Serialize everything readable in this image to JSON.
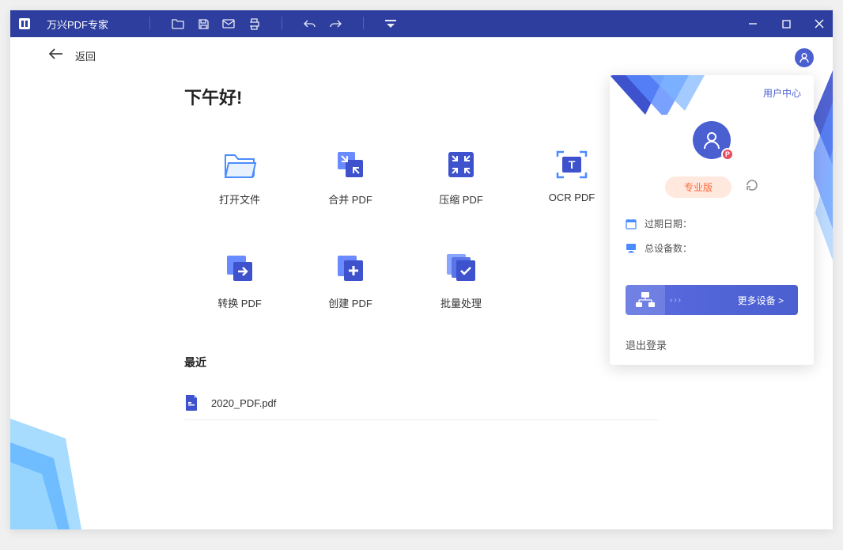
{
  "app": {
    "title": "万兴PDF专家"
  },
  "back": {
    "label": "返回"
  },
  "greeting": "下午好!",
  "actions": [
    {
      "id": "open-file",
      "label": "打开文件"
    },
    {
      "id": "merge-pdf",
      "label": "合并 PDF"
    },
    {
      "id": "compress-pdf",
      "label": "压缩 PDF"
    },
    {
      "id": "ocr-pdf",
      "label": "OCR PDF"
    },
    {
      "id": "convert-pdf",
      "label": "转换 PDF"
    },
    {
      "id": "create-pdf",
      "label": "创建 PDF"
    },
    {
      "id": "batch-process",
      "label": "批量处理"
    }
  ],
  "recent": {
    "title": "最近",
    "files": [
      {
        "name": "2020_PDF.pdf"
      }
    ]
  },
  "userPanel": {
    "userCenterLink": "用户中心",
    "proLabel": "专业版",
    "avatarBadge": "P",
    "expiryLabel": "过期日期：",
    "devicesLabel": "总设备数：",
    "moreDevices": "更多设备 >",
    "logout": "退出登录"
  }
}
